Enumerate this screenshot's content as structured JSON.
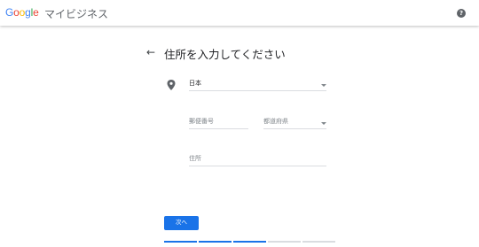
{
  "header": {
    "logo_parts": [
      "G",
      "o",
      "o",
      "g",
      "l",
      "e"
    ],
    "product_name": "マイビジネス",
    "help_icon": "?"
  },
  "page": {
    "back_arrow": "←",
    "title": "住所を入力してください"
  },
  "form": {
    "country": {
      "value": "日本"
    },
    "postal_code": {
      "placeholder": "郵便番号"
    },
    "prefecture": {
      "placeholder": "都道府県"
    },
    "address": {
      "placeholder": "住所"
    }
  },
  "actions": {
    "next_label": "次へ"
  },
  "progress": {
    "total_steps": 5,
    "completed_steps": 3,
    "active_color": "#1a73e8",
    "inactive_color": "#dadce0"
  },
  "colors": {
    "accent": "#1a73e8"
  }
}
